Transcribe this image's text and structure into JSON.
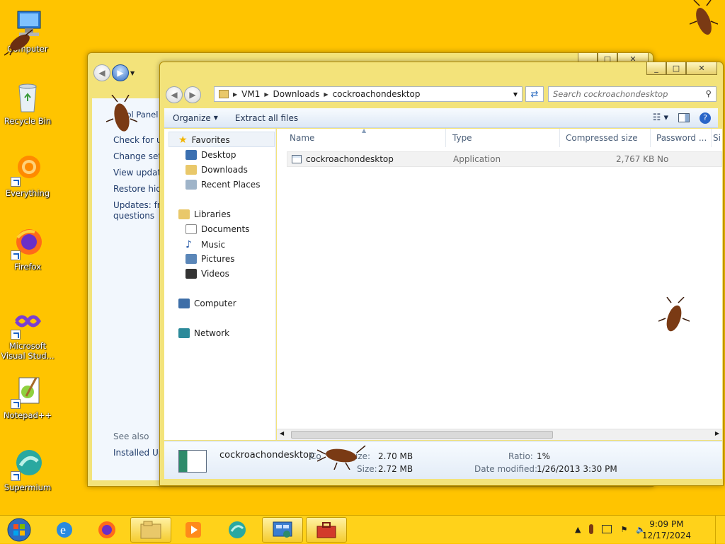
{
  "desktop": {
    "icons": [
      {
        "label": "Computer",
        "icon": "computer-icon"
      },
      {
        "label": "Recycle Bin",
        "icon": "recycle-bin-icon"
      },
      {
        "label": "Everything",
        "icon": "everything-icon"
      },
      {
        "label": "Firefox",
        "icon": "firefox-icon"
      },
      {
        "label": "Microsoft Visual Stud...",
        "icon": "visual-studio-icon"
      },
      {
        "label": "Notepad++",
        "icon": "notepadpp-icon"
      },
      {
        "label": "Supermium",
        "icon": "supermium-icon"
      }
    ]
  },
  "back_window": {
    "title_fragment": "rol Panel",
    "links": [
      "Check for up",
      "Change setti",
      "View update",
      "Restore hidd",
      "Updates: free",
      "questions"
    ],
    "see_also": "See also",
    "installed": "Installed Upd"
  },
  "explorer": {
    "breadcrumb": [
      "VM1",
      "Downloads",
      "cockroachondesktop"
    ],
    "search_placeholder": "Search cockroachondesktop",
    "toolbar": {
      "organize": "Organize",
      "extract": "Extract all files"
    },
    "nav": {
      "favorites": "Favorites",
      "favorites_items": [
        "Desktop",
        "Downloads",
        "Recent Places"
      ],
      "libraries": "Libraries",
      "libraries_items": [
        "Documents",
        "Music",
        "Pictures",
        "Videos"
      ],
      "computer": "Computer",
      "network": "Network"
    },
    "columns": [
      "Name",
      "Type",
      "Compressed size",
      "Password ...",
      "Si"
    ],
    "files": [
      {
        "name": "cockroachondesktop",
        "type": "Application",
        "compressed_size": "2,767 KB",
        "password": "No"
      }
    ],
    "details": {
      "name": "cockroachondesktop",
      "comp_prefix": "Co",
      "size_label_1": "ize:",
      "size_1": "2.70 MB",
      "size_label_2": "Size:",
      "size_2": "2.72 MB",
      "ratio_label": "Ratio:",
      "ratio": "1%",
      "date_label": "Date modified:",
      "date": "1/26/2013 3:30 PM"
    }
  },
  "taskbar": {
    "time": "9:09 PM",
    "date": "12/17/2024"
  },
  "colors": {
    "desktop": "#ffc400",
    "taskbar": "#ffd21a",
    "window_frame": "#f3e37a"
  }
}
